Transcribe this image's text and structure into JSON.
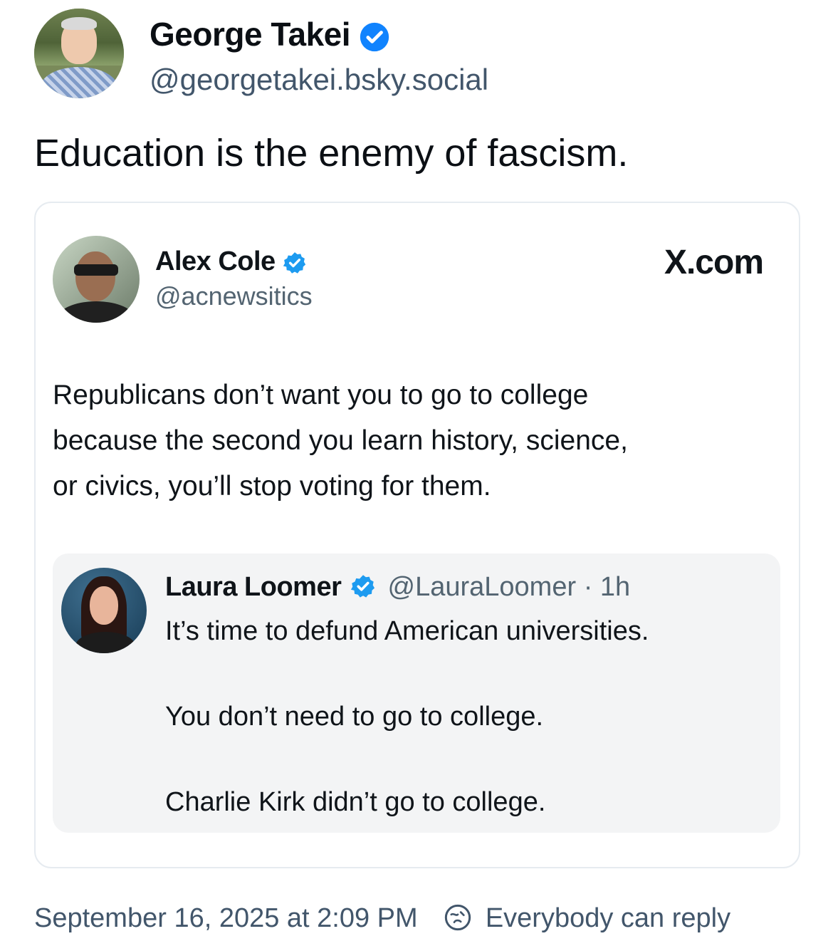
{
  "post": {
    "author_name": "George Takei",
    "author_handle": "@georgetakei.bsky.social",
    "text": "Education is the enemy of fascism.",
    "timestamp": "September 16, 2025 at 2:09 PM",
    "reply_setting": "Everybody can reply"
  },
  "embed": {
    "author_name": "Alex Cole",
    "author_handle": "@acnewsitics",
    "source": "X.com",
    "text_lines": [
      "Republicans don’t want you to go to college",
      "because the second you learn history, science,",
      "or civics, you’ll stop voting for them."
    ],
    "quote": {
      "author_name": "Laura Loomer",
      "author_handle": "@LauraLoomer",
      "separator": "·",
      "time": "1h",
      "lines": [
        "It’s time to defund American universities.",
        "You don’t need to go to college.",
        "Charlie Kirk didn’t go to college."
      ]
    }
  },
  "colors": {
    "verified_bluesky": "#1083fe",
    "verified_x": "#1d9bf0",
    "secondary_text": "#42566b",
    "quote_background": "#f3f4f5"
  },
  "icons": {
    "verified": "verified-check-icon",
    "reply": "reply-restriction-icon"
  }
}
